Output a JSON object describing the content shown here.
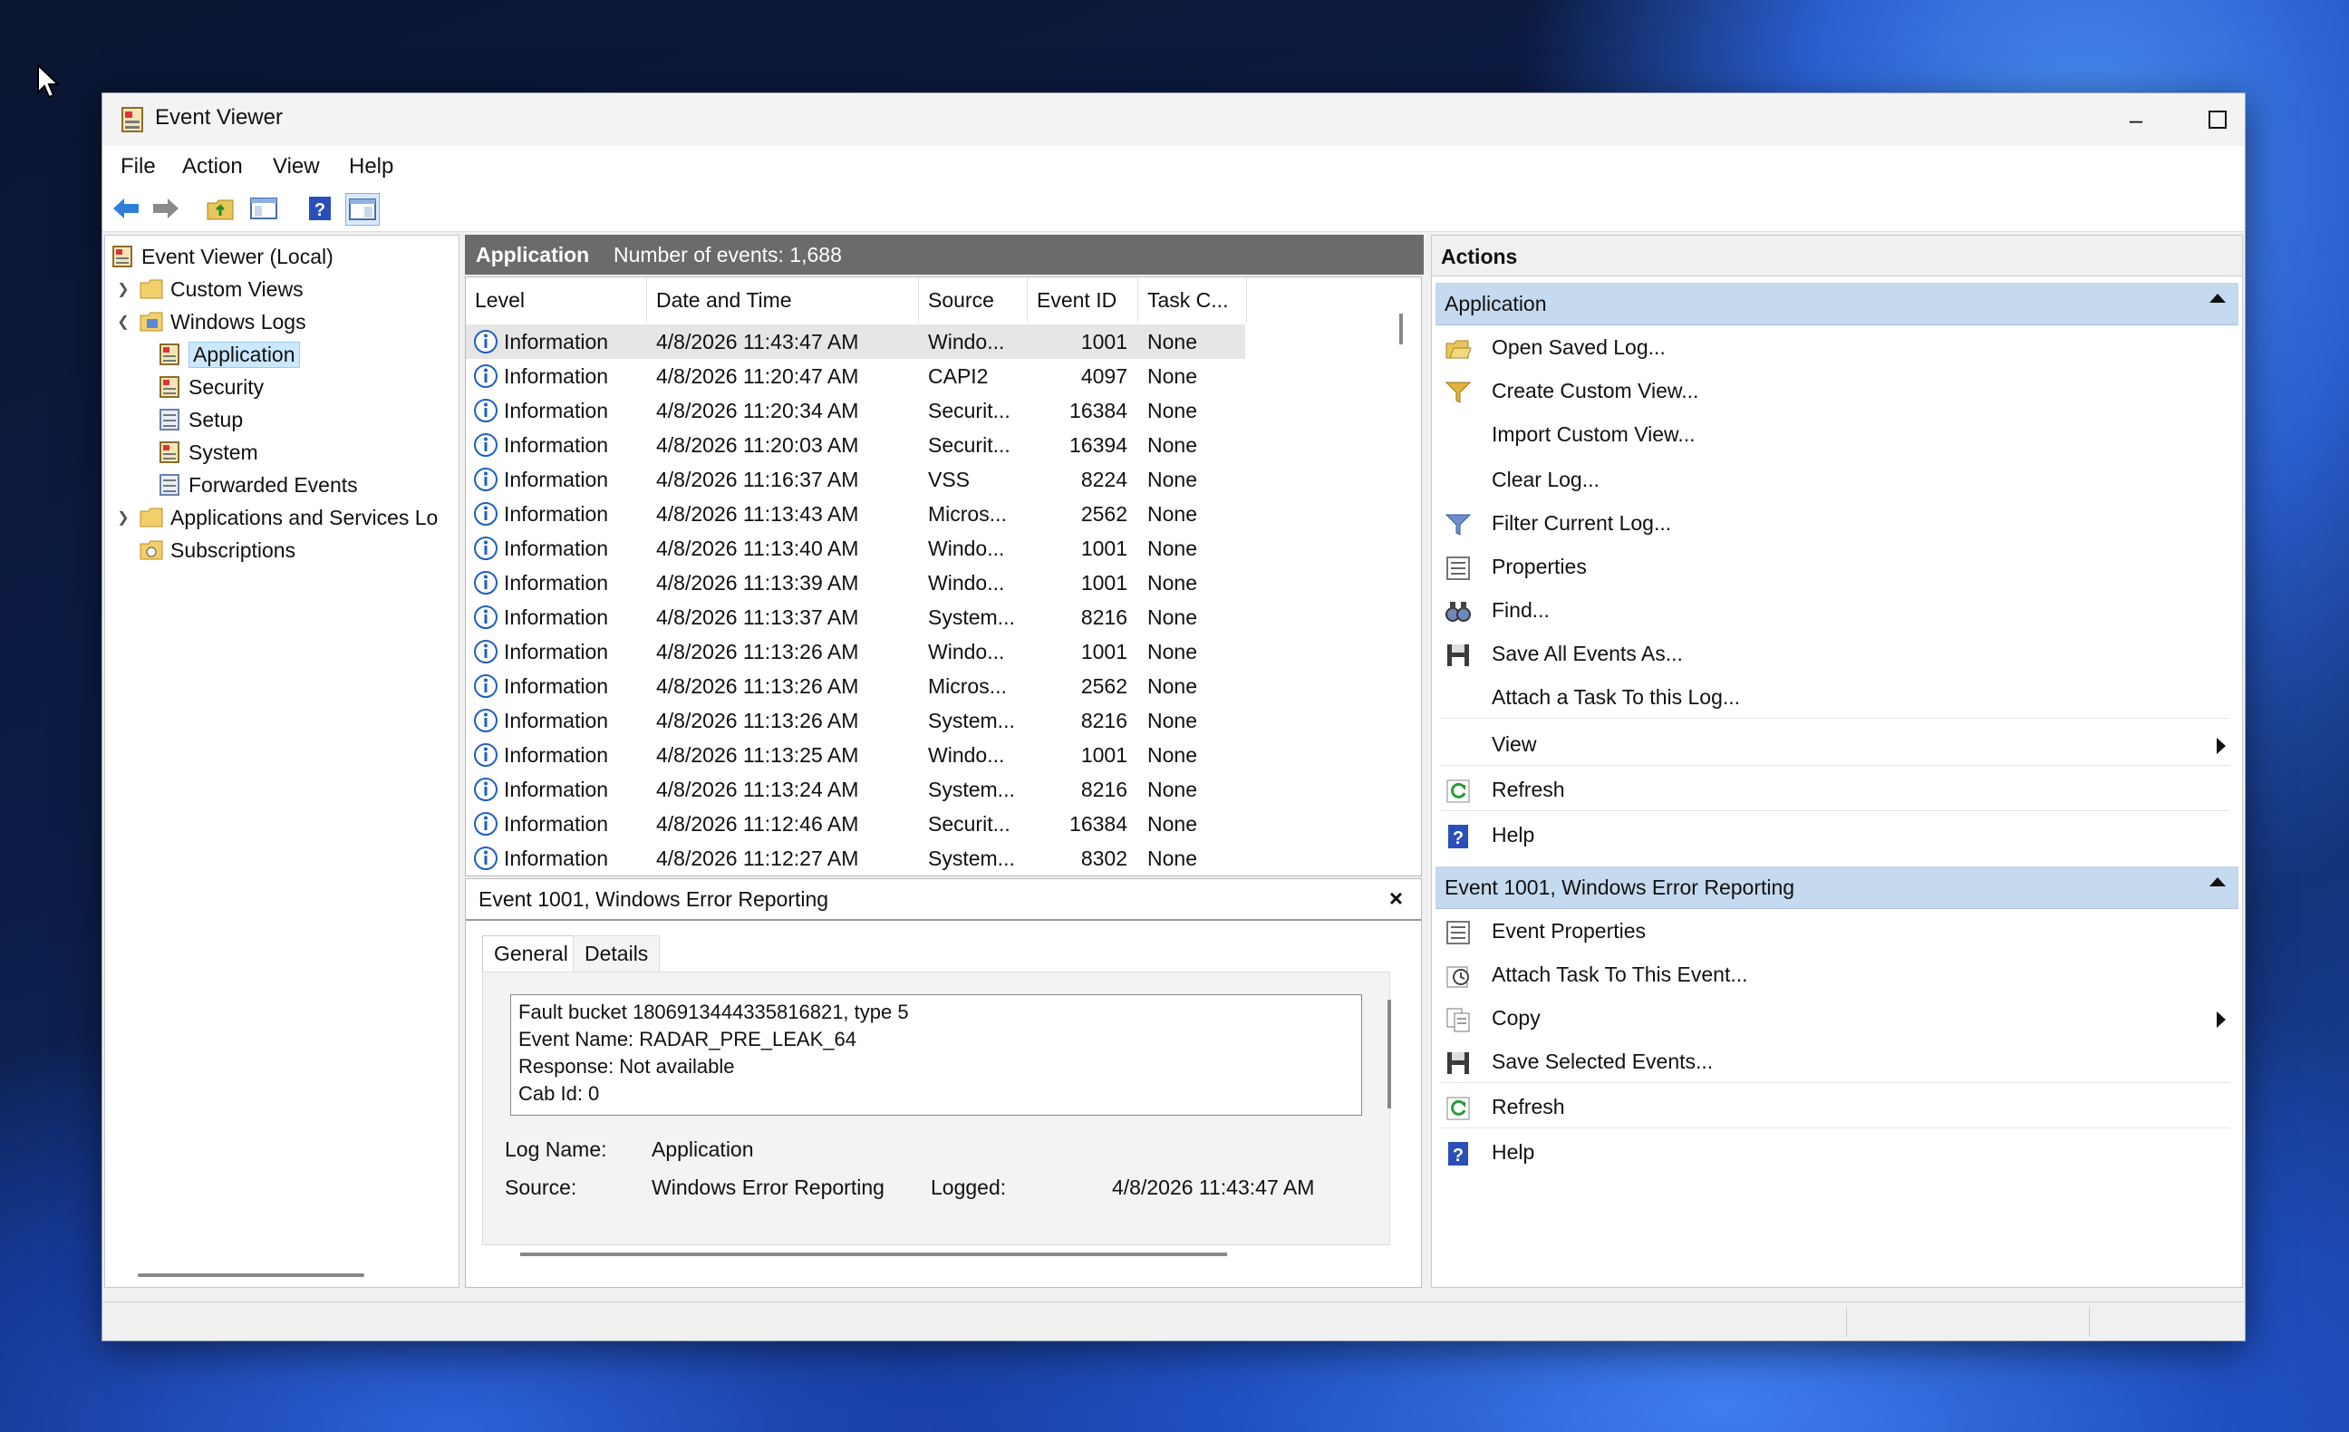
{
  "window": {
    "title": "Event Viewer"
  },
  "menu": [
    "File",
    "Action",
    "View",
    "Help"
  ],
  "tree": {
    "root": "Event Viewer (Local)",
    "custom_views": "Custom Views",
    "windows_logs": "Windows Logs",
    "logs": [
      "Application",
      "Security",
      "Setup",
      "System",
      "Forwarded Events"
    ],
    "apps_services": "Applications and Services Lo",
    "subscriptions": "Subscriptions"
  },
  "list_header": {
    "name": "Application",
    "count_text": "Number of events: 1,688"
  },
  "columns": [
    "Level",
    "Date and Time",
    "Source",
    "Event ID",
    "Task C..."
  ],
  "events": [
    {
      "level": "Information",
      "datetime": "4/8/2026 11:43:47 AM",
      "source": "Windo...",
      "id": "1001",
      "task": "None"
    },
    {
      "level": "Information",
      "datetime": "4/8/2026 11:20:47 AM",
      "source": "CAPI2",
      "id": "4097",
      "task": "None"
    },
    {
      "level": "Information",
      "datetime": "4/8/2026 11:20:34 AM",
      "source": "Securit...",
      "id": "16384",
      "task": "None"
    },
    {
      "level": "Information",
      "datetime": "4/8/2026 11:20:03 AM",
      "source": "Securit...",
      "id": "16394",
      "task": "None"
    },
    {
      "level": "Information",
      "datetime": "4/8/2026 11:16:37 AM",
      "source": "VSS",
      "id": "8224",
      "task": "None"
    },
    {
      "level": "Information",
      "datetime": "4/8/2026 11:13:43 AM",
      "source": "Micros...",
      "id": "2562",
      "task": "None"
    },
    {
      "level": "Information",
      "datetime": "4/8/2026 11:13:40 AM",
      "source": "Windo...",
      "id": "1001",
      "task": "None"
    },
    {
      "level": "Information",
      "datetime": "4/8/2026 11:13:39 AM",
      "source": "Windo...",
      "id": "1001",
      "task": "None"
    },
    {
      "level": "Information",
      "datetime": "4/8/2026 11:13:37 AM",
      "source": "System...",
      "id": "8216",
      "task": "None"
    },
    {
      "level": "Information",
      "datetime": "4/8/2026 11:13:26 AM",
      "source": "Windo...",
      "id": "1001",
      "task": "None"
    },
    {
      "level": "Information",
      "datetime": "4/8/2026 11:13:26 AM",
      "source": "Micros...",
      "id": "2562",
      "task": "None"
    },
    {
      "level": "Information",
      "datetime": "4/8/2026 11:13:26 AM",
      "source": "System...",
      "id": "8216",
      "task": "None"
    },
    {
      "level": "Information",
      "datetime": "4/8/2026 11:13:25 AM",
      "source": "Windo...",
      "id": "1001",
      "task": "None"
    },
    {
      "level": "Information",
      "datetime": "4/8/2026 11:13:24 AM",
      "source": "System...",
      "id": "8216",
      "task": "None"
    },
    {
      "level": "Information",
      "datetime": "4/8/2026 11:12:46 AM",
      "source": "Securit...",
      "id": "16384",
      "task": "None"
    },
    {
      "level": "Information",
      "datetime": "4/8/2026 11:12:27 AM",
      "source": "System...",
      "id": "8302",
      "task": "None"
    }
  ],
  "detail": {
    "title": "Event 1001, Windows Error Reporting",
    "close": "×",
    "tabs": [
      "General",
      "Details"
    ],
    "description_lines": [
      "Fault bucket 1806913444335816821, type 5",
      "Event Name: RADAR_PRE_LEAK_64",
      "Response: Not available",
      "Cab Id: 0"
    ],
    "log_name_label": "Log Name:",
    "log_name": "Application",
    "source_label": "Source:",
    "source": "Windows Error Reporting",
    "logged_label": "Logged:",
    "logged": "4/8/2026 11:43:47 AM"
  },
  "actions": {
    "header": "Actions",
    "section1_title": "Application",
    "section1_items": [
      "Open Saved Log...",
      "Create Custom View...",
      "Import Custom View...",
      "Clear Log...",
      "Filter Current Log...",
      "Properties",
      "Find...",
      "Save All Events As...",
      "Attach a Task To this Log...",
      "View",
      "Refresh",
      "Help"
    ],
    "section2_title": "Event 1001, Windows Error Reporting",
    "section2_items": [
      "Event Properties",
      "Attach Task To This Event...",
      "Copy",
      "Save Selected Events...",
      "Refresh",
      "Help"
    ]
  },
  "colors": {
    "selection": "#cce8ff",
    "section_header": "#c5d9ef",
    "list_header": "#6b6b6b",
    "info_icon": "#1f5fbf"
  }
}
